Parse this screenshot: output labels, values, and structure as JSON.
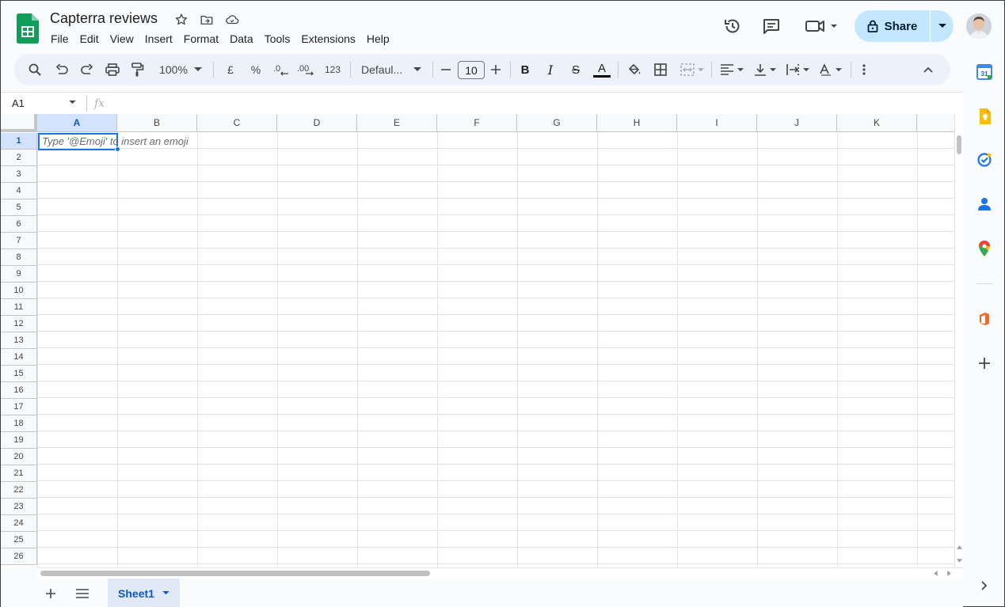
{
  "window": {
    "title": "Capterra reviews"
  },
  "menu": [
    "File",
    "Edit",
    "View",
    "Insert",
    "Format",
    "Data",
    "Tools",
    "Extensions",
    "Help"
  ],
  "header": {
    "share_label": "Share"
  },
  "toolbar": {
    "zoom": "100%",
    "currency_symbol": "£",
    "percent_symbol": "%",
    "decrease_decimal": ".0",
    "increase_decimal": ".00",
    "more_formats": "123",
    "font_family": "Defaul...",
    "font_size": "10",
    "bold": "B",
    "italic": "I",
    "strike": "S",
    "text_color": "A"
  },
  "formula_bar": {
    "name_box": "A1",
    "fx": "fx",
    "value": ""
  },
  "grid": {
    "columns": [
      "A",
      "B",
      "C",
      "D",
      "E",
      "F",
      "G",
      "H",
      "I",
      "J",
      "K"
    ],
    "rows": [
      "1",
      "2",
      "3",
      "4",
      "5",
      "6",
      "7",
      "8",
      "9",
      "10",
      "11",
      "12",
      "13",
      "14",
      "15",
      "16",
      "17",
      "18",
      "19",
      "20",
      "21",
      "22",
      "23",
      "24",
      "25",
      "26"
    ],
    "selected_cell": "A1",
    "active_cell_hint": "Type '@Emoji' to insert an emoji"
  },
  "sheets": {
    "tabs": [
      "Sheet1"
    ],
    "active": "Sheet1"
  },
  "side_panel": [
    "calendar-icon",
    "keep-icon",
    "tasks-icon",
    "contacts-icon",
    "maps-icon",
    "office-addon-icon",
    "add-icon"
  ],
  "colors": {
    "accent_blue": "#1a73e8",
    "share_bg": "#c2e7ff",
    "toolbar_bg": "#edf2fa",
    "sheets_green": "#0f9d58",
    "selection_header": "#d3e3fd"
  }
}
